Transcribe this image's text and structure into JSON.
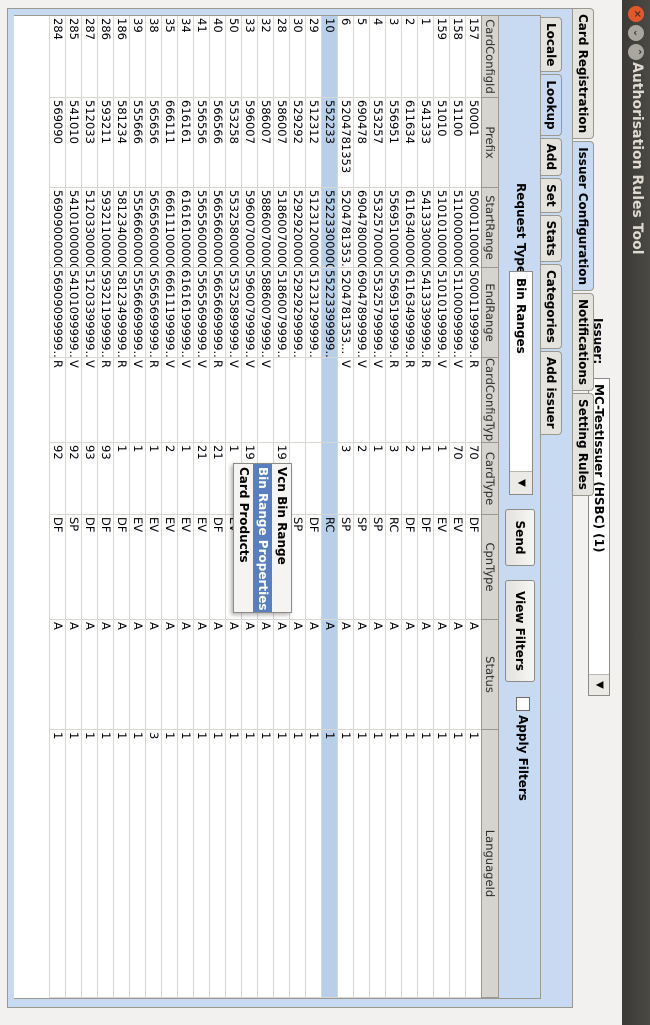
{
  "window": {
    "title": "Authorisation Rules Tool"
  },
  "issuer": {
    "label": "Issuer:",
    "value": "MC-TestIssuer (HSBC) (1)"
  },
  "outer_tabs": [
    {
      "label": "Card Registration",
      "active": false
    },
    {
      "label": "Issuer Configuration",
      "active": true
    },
    {
      "label": "Notifications",
      "active": false
    },
    {
      "label": "Setting Rules",
      "active": false
    }
  ],
  "inner_tabs": [
    {
      "label": "Locale",
      "active": false
    },
    {
      "label": "Lookup",
      "active": true
    },
    {
      "label": "Add",
      "active": false
    },
    {
      "label": "Set",
      "active": false
    },
    {
      "label": "Stats",
      "active": false
    },
    {
      "label": "Categories",
      "active": false
    },
    {
      "label": "Add issuer",
      "active": false
    }
  ],
  "lookup": {
    "request_type_label": "Request Type",
    "request_type_value": "Bin Ranges",
    "send_label": "Send",
    "view_filters_label": "View Filters",
    "apply_filters_label": "Apply Filters"
  },
  "table": {
    "columns": [
      "CardConfigId",
      "Prefix",
      "StartRange",
      "EndRange",
      "CardConfigType",
      "CardType",
      "CpnType",
      "Status",
      "LanguageId"
    ],
    "selected_row": 9,
    "rows": [
      [
        "157",
        "50001",
        "50001100000...",
        "50001199999...",
        "R",
        "70",
        "DF",
        "A",
        "1"
      ],
      [
        "158",
        "51100",
        "51100000000...",
        "51100099999...",
        "V",
        "70",
        "EV",
        "A",
        "1"
      ],
      [
        "159",
        "51010",
        "51010100000...",
        "51010199999...",
        "V",
        "1",
        "EV",
        "A",
        "1"
      ],
      [
        "1",
        "541333",
        "54133300000...",
        "54133399999...",
        "R",
        "1",
        "DF",
        "A",
        "1"
      ],
      [
        "2",
        "611634",
        "61163400000...",
        "61163499999...",
        "R",
        "2",
        "DF",
        "A",
        "1"
      ],
      [
        "3",
        "556951",
        "55695100000...",
        "55695199999...",
        "R",
        "3",
        "RC",
        "A",
        "1"
      ],
      [
        "4",
        "553257",
        "55325700000...",
        "55325799999...",
        "V",
        "1",
        "SP",
        "A",
        "1"
      ],
      [
        "5",
        "690478",
        "69047800000...",
        "69047899999...",
        "V",
        "2",
        "SP",
        "A",
        "1"
      ],
      [
        "6",
        "5204781353",
        "5204781353...",
        "5204781353...",
        "V",
        "3",
        "SP",
        "A",
        "1"
      ],
      [
        "10",
        "552233",
        "55223300000...",
        "55223399999...",
        "",
        "",
        "RC",
        "A",
        "1"
      ],
      [
        "29",
        "512312",
        "51231200000...",
        "51231299999...",
        "",
        "",
        "DF",
        "A",
        "1"
      ],
      [
        "30",
        "529292",
        "52929200000...",
        "52929299999...",
        "",
        "",
        "SP",
        "A",
        "1"
      ],
      [
        "28",
        "586007",
        "51860070000...",
        "51860079999...",
        "",
        "19",
        "DF",
        "A",
        "1"
      ],
      [
        "32",
        "586007",
        "58860070000...",
        "58860079999...",
        "V",
        "",
        "SP",
        "A",
        "1"
      ],
      [
        "33",
        "596007",
        "59600700000...",
        "59600799999...",
        "V",
        "19",
        "EV",
        "A",
        "1"
      ],
      [
        "50",
        "553258",
        "55325800000...",
        "55325899999...",
        "V",
        "1",
        "EV",
        "A",
        "1"
      ],
      [
        "40",
        "566566",
        "56656600000...",
        "56656699999...",
        "R",
        "21",
        "DF",
        "A",
        "1"
      ],
      [
        "41",
        "556556",
        "55655600000...",
        "55655699999...",
        "V",
        "21",
        "EV",
        "A",
        "1"
      ],
      [
        "34",
        "616161",
        "61616100000...",
        "61616199999...",
        "V",
        "1",
        "EV",
        "A",
        "1"
      ],
      [
        "35",
        "666111",
        "66611100000...",
        "66611199999...",
        "V",
        "2",
        "EV",
        "A",
        "1"
      ],
      [
        "38",
        "565656",
        "56565600000...",
        "56565699999...",
        "R",
        "1",
        "EV",
        "A",
        "3"
      ],
      [
        "39",
        "555666",
        "55566600000...",
        "55566699999...",
        "V",
        "1",
        "EV",
        "A",
        "1"
      ],
      [
        "186",
        "581234",
        "58123400000...",
        "58123499999...",
        "R",
        "1",
        "DF",
        "A",
        "1"
      ],
      [
        "286",
        "593211",
        "59321100000...",
        "59321199999...",
        "R",
        "93",
        "DF",
        "A",
        "1"
      ],
      [
        "287",
        "512033",
        "51203300000...",
        "51203399999...",
        "V",
        "93",
        "DF",
        "A",
        "1"
      ],
      [
        "285",
        "541010",
        "54101000000...",
        "54101099999...",
        "V",
        "92",
        "SP",
        "A",
        "1"
      ],
      [
        "284",
        "569090",
        "56909000000...",
        "56909099999...",
        "R",
        "92",
        "DF",
        "A",
        "1"
      ]
    ]
  },
  "context_menu": {
    "items": [
      {
        "label": "Vcn Bin Range",
        "highlighted": false
      },
      {
        "label": "Bin Range Properties",
        "highlighted": true
      },
      {
        "label": "Card Products",
        "highlighted": false
      }
    ]
  },
  "colors": {
    "panel": "#c8daf2",
    "selected_row": "#b7cfe9",
    "menu_highlight": "#5a7fbf",
    "titlebar": "#3b3a36",
    "close_button": "#e2582d"
  }
}
